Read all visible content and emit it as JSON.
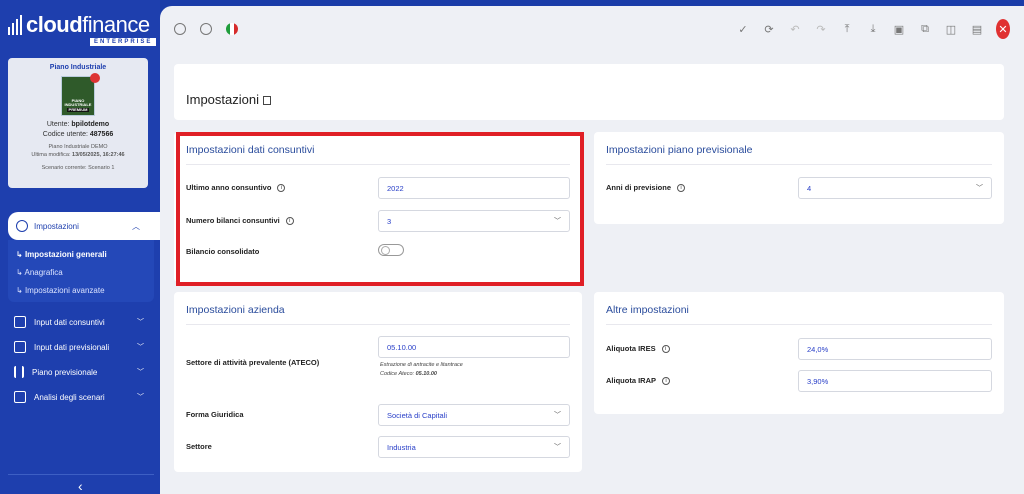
{
  "brand": {
    "name_bold": "cloud",
    "name_thin": "finance",
    "edition": "ENTERPRISE"
  },
  "card": {
    "title": "Piano Industriale",
    "badge_line1": "PIANO",
    "badge_line2": "INDUSTRIALE",
    "badge_line3": "PREMIUM",
    "user_label": "Utente:",
    "user_value": "bpilotdemo",
    "code_label": "Codice utente:",
    "code_value": "487566",
    "plan_name": "Piano Industriale DEMO",
    "last_edit_label": "Ultima modifica:",
    "last_edit_value": "13/05/2025, 16:27:46",
    "scenario": "Scenario corrente: Scenario 1"
  },
  "nav": {
    "active": "Impostazioni",
    "sub_items": [
      "Impostazioni generali",
      "Anagrafica",
      "Impostazioni avanzate"
    ],
    "items": [
      "Input dati consuntivi",
      "Input dati previsionali",
      "Piano previsionale",
      "Analisi degli scenari"
    ]
  },
  "page_title": "Impostazioni",
  "consuntivi": {
    "title": "Impostazioni dati consuntivi",
    "last_year_label": "Ultimo anno consuntivo",
    "last_year_value": "2022",
    "count_label": "Numero bilanci consuntivi",
    "count_value": "3",
    "consolidated_label": "Bilancio consolidato"
  },
  "previsionale": {
    "title": "Impostazioni piano previsionale",
    "years_label": "Anni di previsione",
    "years_value": "4"
  },
  "azienda": {
    "title": "Impostazioni azienda",
    "sector_label": "Settore di attività prevalente (ATECO)",
    "sector_value": "05.10.00",
    "sector_desc": "Estrazione di antracite e litantrace",
    "ateco_label": "Codice Ateco:",
    "ateco_value": "05.10.00",
    "legal_label": "Forma Giuridica",
    "legal_value": "Società di Capitali",
    "settore_label": "Settore",
    "settore_value": "Industria"
  },
  "altre": {
    "title": "Altre impostazioni",
    "ires_label": "Aliquota IRES",
    "ires_value": "24,0%",
    "irap_label": "Aliquota IRAP",
    "irap_value": "3,90%"
  },
  "colors": {
    "sidebar": "#1e3fae",
    "accent": "#2a4c9c",
    "highlight": "#e01f26",
    "close": "#e03131"
  }
}
